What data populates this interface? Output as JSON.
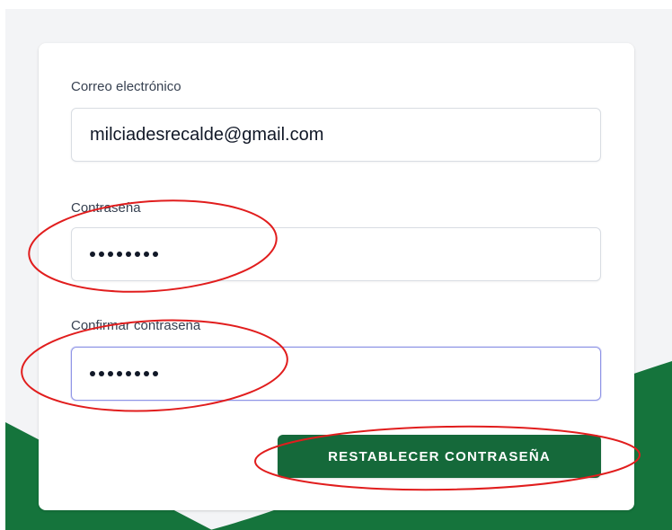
{
  "form": {
    "email": {
      "label": "Correo electrónico",
      "value": "milciadesrecalde@gmail.com"
    },
    "password": {
      "label": "Contraseña",
      "masked_length": 8
    },
    "confirm_password": {
      "label": "Confirmar contraseña",
      "masked_length": 8
    },
    "submit_label": "RESTABLECER CONTRASEÑA"
  },
  "colors": {
    "page_background": "#f3f4f6",
    "card_background": "#ffffff",
    "brand_green": "#15693a",
    "focus_border": "#8f95e6",
    "annotation_red": "#e11d1d"
  }
}
